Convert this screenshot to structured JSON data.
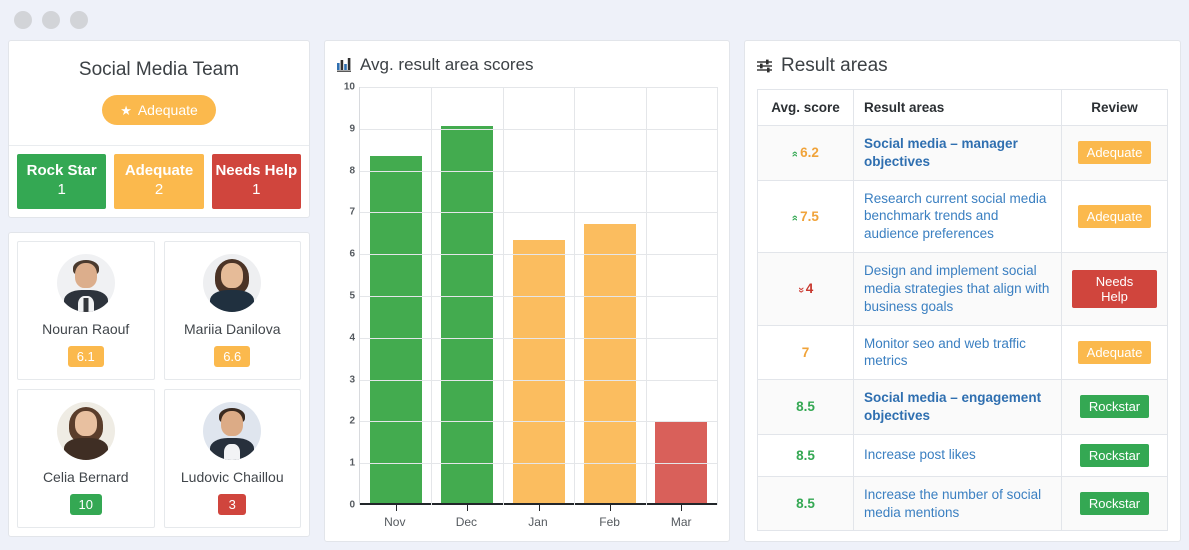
{
  "window": {
    "dots": [
      "minimize-dot",
      "maximize-dot",
      "close-dot"
    ]
  },
  "team": {
    "title": "Social Media Team",
    "badge_label": "Adequate",
    "badge_icon": "star-icon",
    "badge_color": "#fbb94d",
    "stats": [
      {
        "label": "Rock Star",
        "value": "1",
        "color": "#34a853"
      },
      {
        "label": "Adequate",
        "value": "2",
        "color": "#fbb94d"
      },
      {
        "label": "Needs Help",
        "value": "1",
        "color": "#d0453d"
      }
    ]
  },
  "members": [
    {
      "name": "Nouran Raouf",
      "score": "6.1",
      "color": "#fbb94d"
    },
    {
      "name": "Mariia Danilova",
      "score": "6.6",
      "color": "#fbb94d"
    },
    {
      "name": "Celia Bernard",
      "score": "10",
      "color": "#34a853"
    },
    {
      "name": "Ludovic Chaillou",
      "score": "3",
      "color": "#d0453d"
    }
  ],
  "chart": {
    "title": "Avg. result area scores",
    "title_icon": "bar-chart-icon"
  },
  "chart_data": {
    "type": "bar",
    "title": "Avg. result area scores",
    "xlabel": "",
    "ylabel": "",
    "categories": [
      "Nov",
      "Dec",
      "Jan",
      "Feb",
      "Mar"
    ],
    "values": [
      8.35,
      9.07,
      6.35,
      6.72,
      2.0
    ],
    "bar_colors": [
      "#43ab4f",
      "#43ab4f",
      "#fbbd5f",
      "#fbbd5f",
      "#d9605a"
    ],
    "ylim": [
      0,
      10
    ],
    "yticks": [
      0,
      1,
      2,
      3,
      4,
      5,
      6,
      7,
      8,
      9,
      10
    ],
    "ytick_labels": [
      "0",
      "1",
      "2",
      "3",
      "4",
      "5",
      "6",
      "7",
      "8",
      "9",
      "10"
    ],
    "grid": true,
    "legend": false
  },
  "result_areas": {
    "title": "Result areas",
    "title_icon": "sliders-icon",
    "columns": [
      "Avg. score",
      "Result areas",
      "Review"
    ],
    "rows": [
      {
        "score": "6.2",
        "trend": "up",
        "score_color": "orange",
        "area": "Social media – manager objectives",
        "bold": true,
        "review": "Adequate",
        "review_color": "#fbb94d"
      },
      {
        "score": "7.5",
        "trend": "up",
        "score_color": "orange",
        "area": "Research current social media benchmark trends and audience preferences",
        "bold": false,
        "review": "Adequate",
        "review_color": "#fbb94d"
      },
      {
        "score": "4",
        "trend": "down",
        "score_color": "red",
        "area": "Design and implement social media strategies that align with business goals",
        "bold": false,
        "review": "Needs Help",
        "review_color": "#d0453d"
      },
      {
        "score": "7",
        "trend": "none",
        "score_color": "orange",
        "area": "Monitor seo and web traffic metrics",
        "bold": false,
        "review": "Adequate",
        "review_color": "#fbb94d"
      },
      {
        "score": "8.5",
        "trend": "none",
        "score_color": "green",
        "area": "Social media – engagement objectives",
        "bold": true,
        "review": "Rockstar",
        "review_color": "#34a853"
      },
      {
        "score": "8.5",
        "trend": "none",
        "score_color": "green",
        "area": "Increase post likes",
        "bold": false,
        "review": "Rockstar",
        "review_color": "#34a853"
      },
      {
        "score": "8.5",
        "trend": "none",
        "score_color": "green",
        "area": "Increase the number of social media mentions",
        "bold": false,
        "review": "Rockstar",
        "review_color": "#34a853"
      }
    ]
  }
}
